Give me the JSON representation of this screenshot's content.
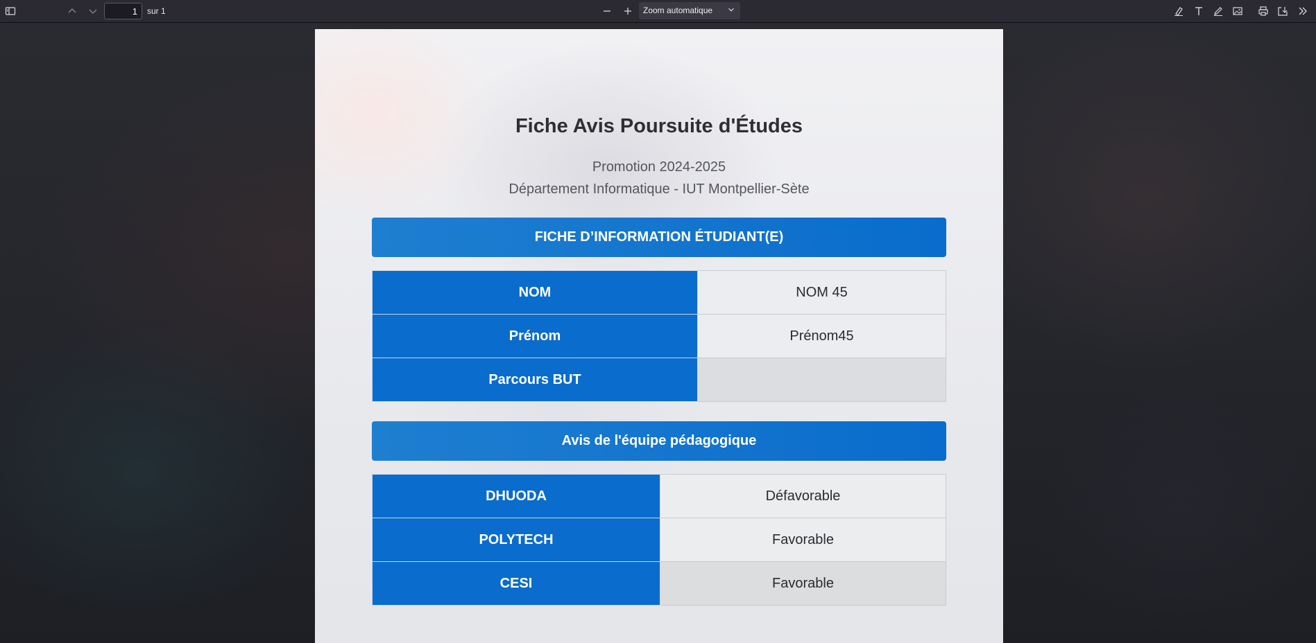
{
  "toolbar": {
    "page_number": "1",
    "page_count": "sur 1",
    "zoom": "Zoom automatique"
  },
  "document": {
    "title": "Fiche Avis Poursuite d'Études",
    "promotion": "Promotion 2024-2025",
    "department": "Département Informatique - IUT Montpellier-Sète",
    "student_section": {
      "heading": "FICHE D’INFORMATION ÉTUDIANT(E)",
      "rows": [
        {
          "label": "NOM",
          "value": "NOM 45"
        },
        {
          "label": "Prénom",
          "value": "Prénom45"
        },
        {
          "label": "Parcours BUT",
          "value": ""
        }
      ]
    },
    "opinion_section": {
      "heading": "Avis de l'équipe pédagogique",
      "rows": [
        {
          "label": "DHUODA",
          "value": "Défavorable"
        },
        {
          "label": "POLYTECH",
          "value": "Favorable"
        },
        {
          "label": "CESI",
          "value": "Favorable"
        }
      ]
    }
  },
  "colors": {
    "accent": "#0a6ccc",
    "toolbar": "#2b2a33"
  }
}
